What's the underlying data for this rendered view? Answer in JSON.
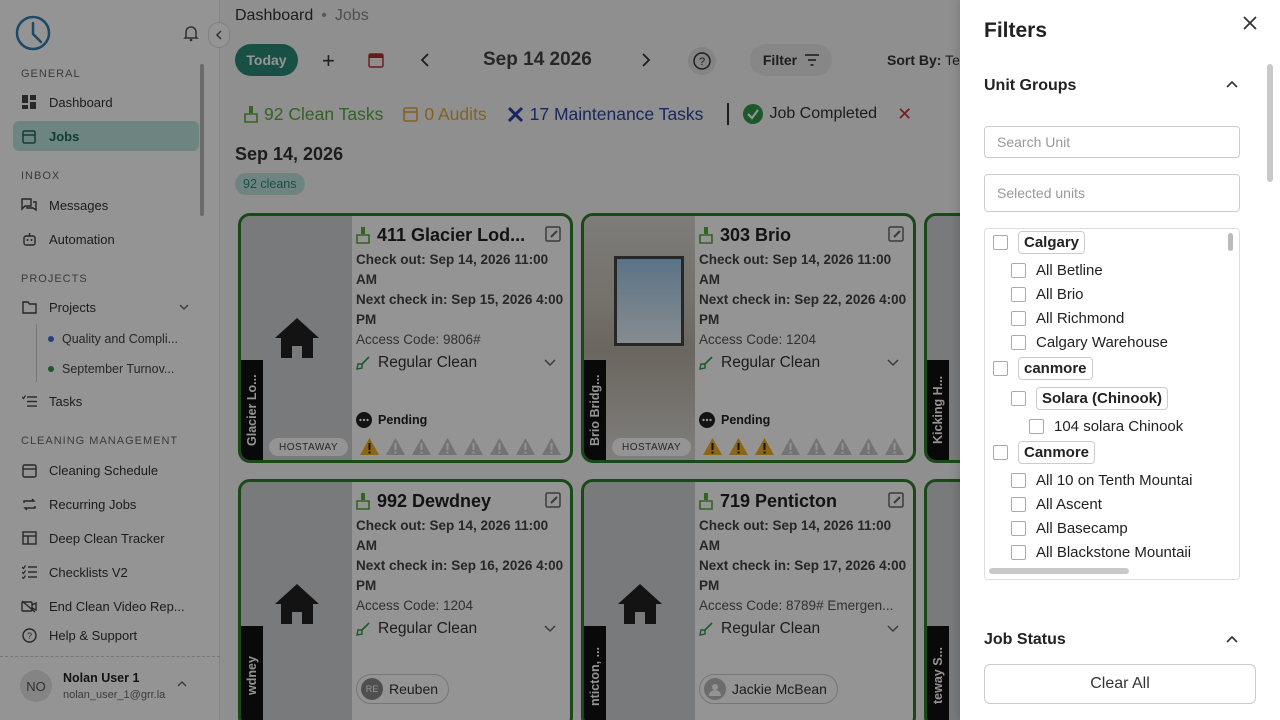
{
  "sidebar": {
    "sections": {
      "general": "GENERAL",
      "inbox": "INBOX",
      "projects": "PROJECTS",
      "cleaning": "CLEANING MANAGEMENT"
    },
    "items": {
      "dashboard": "Dashboard",
      "jobs": "Jobs",
      "messages": "Messages",
      "automation": "Automation",
      "projects": "Projects",
      "project_1": "Quality and Compli...",
      "project_2": "September Turnov...",
      "tasks": "Tasks",
      "cleaning_schedule": "Cleaning Schedule",
      "recurring_jobs": "Recurring Jobs",
      "deep_clean": "Deep Clean Tracker",
      "checklists": "Checklists V2",
      "end_clean_video": "End Clean Video Rep...",
      "help": "Help & Support"
    },
    "project_colors": {
      "project_1": "#3b6fd8",
      "project_2": "#2f9a47"
    },
    "user": {
      "initials": "NO",
      "name": "Nolan User 1",
      "email": "nolan_user_1@grr.la"
    }
  },
  "header": {
    "breadcrumb_root": "Dashboard",
    "breadcrumb_sep": "•",
    "breadcrumb_current": "Jobs",
    "today_label": "Today",
    "plus": "+",
    "date": "Sep 14 2026",
    "filter_label": "Filter",
    "sort_label": "Sort By:",
    "sort_value": "Te"
  },
  "summary": {
    "clean_tasks": "92 Clean Tasks",
    "audits": "0 Audits",
    "maintenance": "17 Maintenance Tasks",
    "job_completed": "Job Completed",
    "date_heading": "Sep 14, 2026",
    "cleans_badge": "92 cleans",
    "colors": {
      "clean": "#5aab3e",
      "audit": "#e3a73a",
      "maintenance": "#2d43a8",
      "completed": "#2f9a47"
    }
  },
  "cards": [
    {
      "title": "411 Glacier Lod...",
      "checkout": "Check out: Sep 14, 2026 11:00 AM",
      "next_checkin": "Next check in: Sep 15, 2026 4:00 PM",
      "access": "Access Code: 9806#",
      "clean_type": "Regular Clean",
      "status": "Pending",
      "vertical_label": "Glacier Lo...",
      "source": "HOSTAWAY",
      "warnings_active": 1
    },
    {
      "title": "303 Brio",
      "checkout": "Check out: Sep 14, 2026 11:00 AM",
      "next_checkin": "Next check in: Sep 22, 2026 4:00 PM",
      "access": "Access Code: 1204",
      "clean_type": "Regular Clean",
      "status": "Pending",
      "vertical_label": "Brio Bridg...",
      "source": "HOSTAWAY",
      "warnings_active": 3
    },
    {
      "title": "992 Dewdney",
      "checkout": "Check out: Sep 14, 2026 11:00 AM",
      "next_checkin": "Next check in: Sep 16, 2026 4:00 PM",
      "access": "Access Code: 1204",
      "clean_type": "Regular Clean",
      "assignee_initials": "RE",
      "assignee": "Reuben",
      "vertical_label": "wdney"
    },
    {
      "title": "719 Penticton",
      "checkout": "Check out: Sep 14, 2026 11:00 AM",
      "next_checkin": "Next check in: Sep 17, 2026 4:00 PM",
      "access": "Access Code: 8789# Emergen...",
      "clean_type": "Regular Clean",
      "assignee": "Jackie McBean",
      "vertical_label": "nticton, ..."
    }
  ],
  "partial_cards": {
    "top": "Kicking H...",
    "bottom": "teway S..."
  },
  "filters": {
    "title": "Filters",
    "unit_groups": "Unit Groups",
    "search_placeholder": "Search Unit",
    "selected_placeholder": "Selected units",
    "tree": {
      "calgary": "Calgary",
      "all_betline": "All Betline",
      "all_brio": "All Brio",
      "all_richmond": "All Richmond",
      "calgary_warehouse": "Calgary Warehouse",
      "canmore_lower": "canmore",
      "solara": "Solara (Chinook)",
      "solara_104": "104 solara Chinook",
      "canmore": "Canmore",
      "all_10_tenth": "All 10 on Tenth Mountai",
      "all_ascent": "All Ascent",
      "all_basecamp": "All Basecamp",
      "all_blackstone": "All Blackstone Mountaii"
    },
    "job_status": "Job Status",
    "clear_all": "Clear All"
  }
}
